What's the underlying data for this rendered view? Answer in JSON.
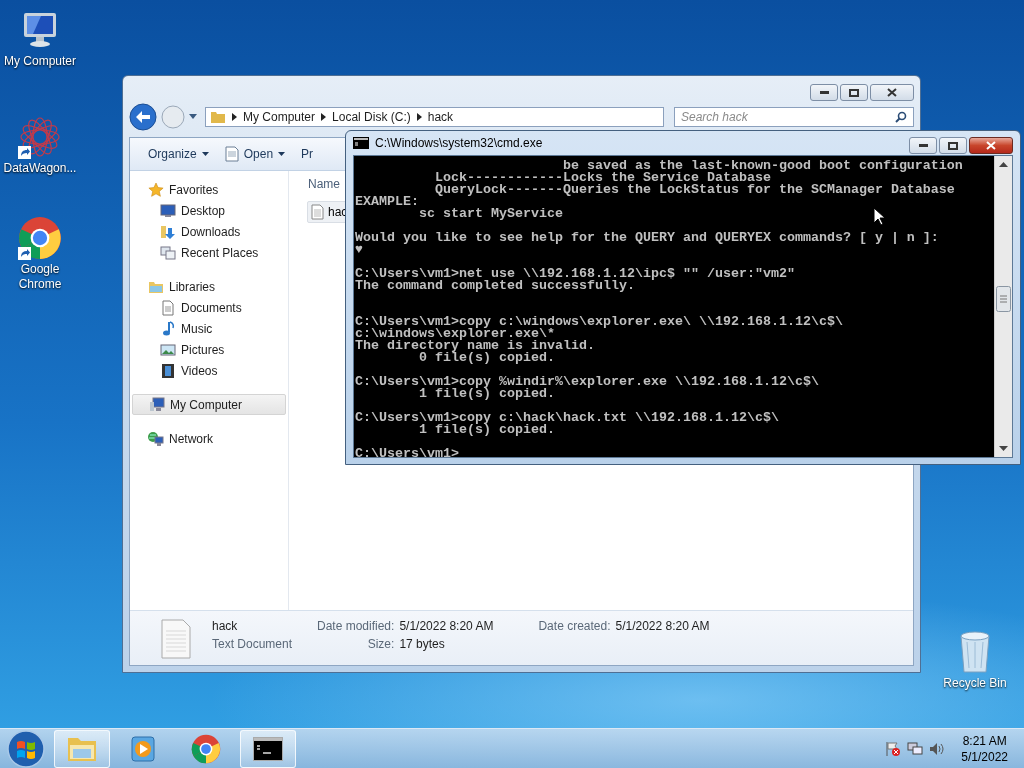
{
  "desktop_icons": [
    {
      "label": "My Computer",
      "shortcut": false
    },
    {
      "label": "DataWagon...",
      "shortcut": true
    },
    {
      "label": "Google Chrome",
      "shortcut": true
    },
    {
      "label": "Recycle Bin",
      "shortcut": false
    }
  ],
  "explorer": {
    "breadcrumb": [
      "My Computer",
      "Local Disk (C:)",
      "hack"
    ],
    "search": {
      "placeholder": "Search hack"
    },
    "toolbar": [
      {
        "label": "Organize",
        "menu": true
      },
      {
        "label": "Open",
        "menu": true
      },
      {
        "label": "Pr",
        "menu": false
      }
    ],
    "nav": [
      {
        "label": "Favorites",
        "selected": false,
        "children": [
          {
            "label": "Desktop",
            "selected": false
          },
          {
            "label": "Downloads",
            "selected": false
          },
          {
            "label": "Recent Places",
            "selected": false
          }
        ]
      },
      {
        "label": "Libraries",
        "selected": false,
        "children": [
          {
            "label": "Documents",
            "selected": false
          },
          {
            "label": "Music",
            "selected": false
          },
          {
            "label": "Pictures",
            "selected": false
          },
          {
            "label": "Videos",
            "selected": false
          }
        ]
      },
      {
        "label": "My Computer",
        "selected": true
      },
      {
        "label": "Network",
        "selected": false
      }
    ],
    "column_header": "Name",
    "files": [
      {
        "name": "hac",
        "selected": true
      }
    ],
    "details": {
      "name": "hack",
      "type": "Text Document",
      "fields": [
        {
          "label": "Date modified:",
          "value": "5/1/2022 8:20 AM"
        },
        {
          "label": "Date created:",
          "value": "5/1/2022 8:20 AM"
        },
        {
          "label": "Size:",
          "value": "17 bytes"
        }
      ]
    }
  },
  "cmd": {
    "title": "C:\\Windows\\system32\\cmd.exe",
    "lines": [
      {
        "kind": "text",
        "text": "                          be saved as the last-known-good boot configuration"
      },
      {
        "kind": "text",
        "text": "          Lock------------Locks the Service Database"
      },
      {
        "kind": "text",
        "text": "          QueryLock-------Queries the LockStatus for the SCManager Database"
      },
      {
        "kind": "text",
        "text": "EXAMPLE:"
      },
      {
        "kind": "text",
        "text": "        sc start MyService"
      },
      {
        "kind": "blank"
      },
      {
        "kind": "text",
        "text": "Would you like to see help for the QUERY and QUERYEX commands? [ y | n ]:"
      },
      {
        "kind": "text",
        "text": "♥"
      },
      {
        "kind": "blank"
      },
      {
        "kind": "text",
        "text": "C:\\Users\\vm1>net use \\\\192.168.1.12\\ipc$ \"\" /user:\"vm2\""
      },
      {
        "kind": "text",
        "text": "The command completed successfully."
      },
      {
        "kind": "blank"
      },
      {
        "kind": "blank"
      },
      {
        "kind": "text",
        "text": "C:\\Users\\vm1>copy c:\\windows\\explorer.exe\\ \\\\192.168.1.12\\c$\\"
      },
      {
        "kind": "text",
        "text": "c:\\windows\\explorer.exe\\*"
      },
      {
        "kind": "text",
        "text": "The directory name is invalid."
      },
      {
        "kind": "text",
        "text": "        0 file(s) copied."
      },
      {
        "kind": "blank"
      },
      {
        "kind": "text",
        "text": "C:\\Users\\vm1>copy %windir%\\explorer.exe \\\\192.168.1.12\\c$\\"
      },
      {
        "kind": "text",
        "text": "        1 file(s) copied."
      },
      {
        "kind": "blank"
      },
      {
        "kind": "text",
        "text": "C:\\Users\\vm1>copy c:\\hack\\hack.txt \\\\192.168.1.12\\c$\\"
      },
      {
        "kind": "text",
        "text": "        1 file(s) copied."
      },
      {
        "kind": "blank"
      },
      {
        "kind": "prompt",
        "text": "C:\\Users\\vm1>"
      }
    ]
  },
  "taskbar": {
    "apps": [
      {
        "open": true
      },
      {
        "open": false
      },
      {
        "open": false
      },
      {
        "open": true
      }
    ],
    "time": "8:21 AM",
    "date": "5/1/2022"
  }
}
